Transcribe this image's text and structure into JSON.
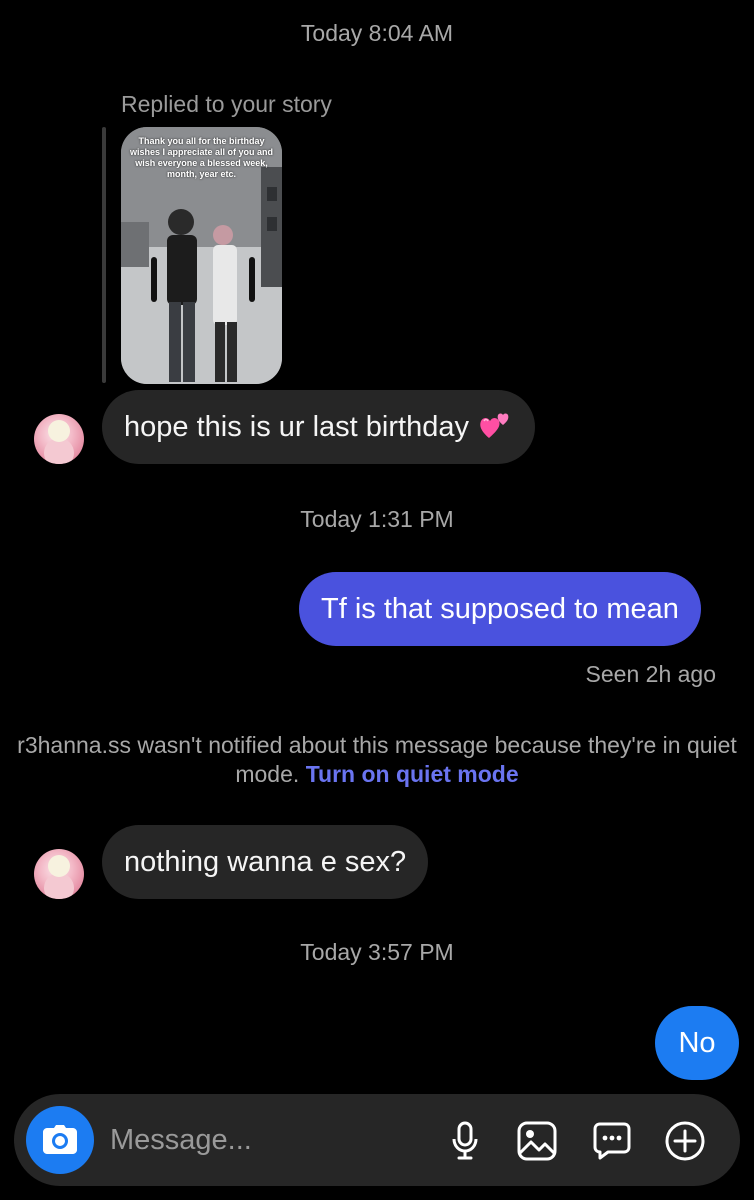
{
  "conversation": {
    "timestamps": [
      "Today 8:04 AM",
      "Today 1:31 PM",
      "Today 3:57 PM"
    ],
    "story_reply": {
      "label": "Replied to your story",
      "story_caption": "Thank you all for the birthday wishes I appreciate all of you and wish everyone a blessed week, month, year etc."
    },
    "messages": [
      {
        "direction": "incoming",
        "text": "hope this is ur last birthday",
        "emoji": "two-hearts-icon"
      },
      {
        "direction": "outgoing",
        "text": "Tf is that supposed to mean"
      },
      {
        "direction": "incoming",
        "text": "nothing wanna e sex?"
      },
      {
        "direction": "outgoing",
        "text": "No"
      }
    ],
    "seen_status": "Seen 2h ago",
    "quiet_mode_notice": {
      "text": "r3hanna.ss wasn't notified about this message because they're in quiet mode.",
      "link": "Turn on quiet mode"
    }
  },
  "composer": {
    "placeholder": "Message...",
    "icons": [
      "camera-icon",
      "microphone-icon",
      "gallery-icon",
      "sticker-chat-icon",
      "plus-icon"
    ]
  },
  "colors": {
    "background": "#000000",
    "incoming_bubble": "#262626",
    "outgoing_bubble": "#4a52de",
    "outgoing_bubble_latest": "#1c7cf2",
    "link": "#6a74f0",
    "camera_button": "#1c7cf2"
  }
}
